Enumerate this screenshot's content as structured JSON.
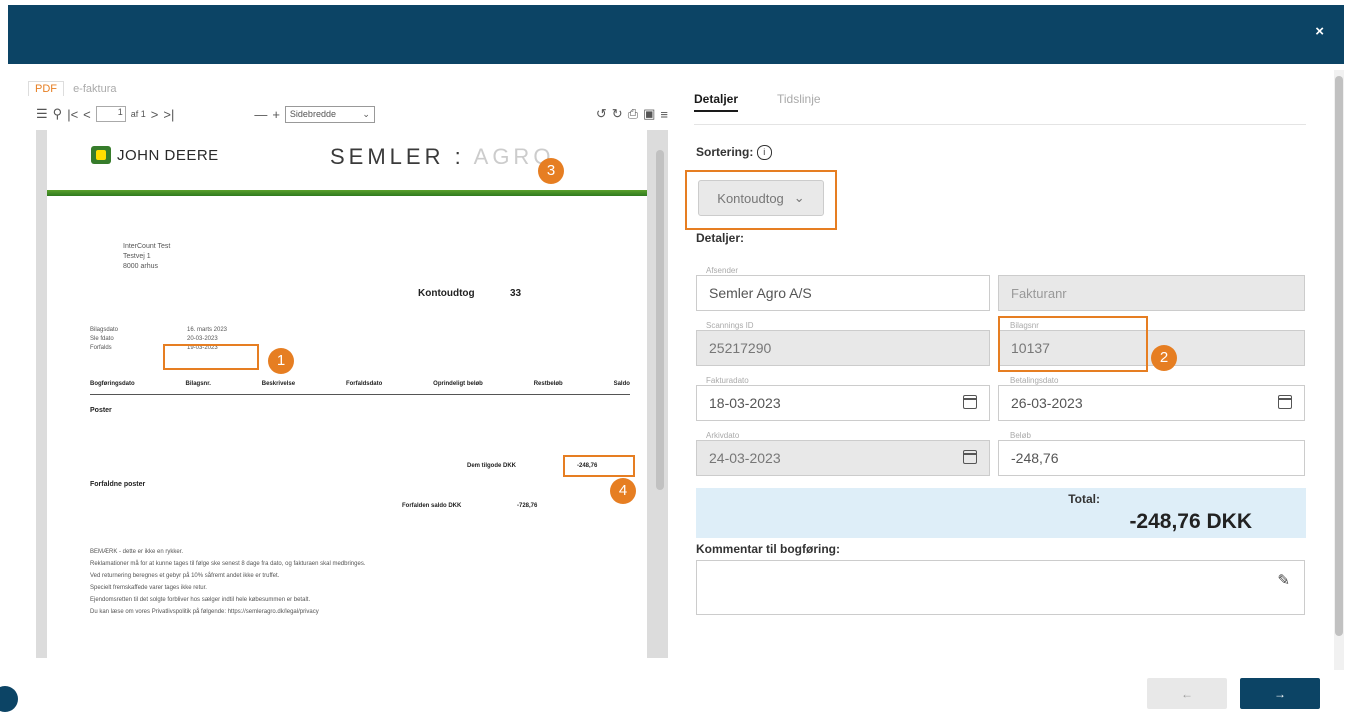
{
  "header": {
    "close_label": "×"
  },
  "pdf": {
    "tabs": [
      "PDF",
      "e-faktura"
    ],
    "page_current": "1",
    "page_total": "af 1",
    "zoom_label": "Sidebredde",
    "doc": {
      "brand_left": "JOHN DEERE",
      "brand_right_main": "SEMLER",
      "brand_right_colon": ":",
      "brand_right_sub": "AGRO",
      "address": [
        "InterCount Test",
        "Testvej 1",
        "8000 arhus"
      ],
      "doc_title": "Kontoudtog",
      "doc_number": "33",
      "meta_labels": [
        "Bilagsdato",
        "Sle fdato",
        "Forfalds"
      ],
      "meta_values": [
        "16. marts 2023",
        "20-03-2023",
        "19-03-2023"
      ],
      "col_headers": [
        "Bogføringsdato",
        "Bilagsnr.",
        "Beskrivelse",
        "Forfaldsdato",
        "Oprindeligt beløb",
        "Restbeløb",
        "Saldo"
      ],
      "section_posts": "Poster",
      "section_overdue": "Forfaldne poster",
      "due_total_label": "Dem tilgode DKK",
      "due_total_value": "-248,76",
      "overdue_total_label": "Forfalden saldo DKK",
      "overdue_total_value": "-728,76",
      "footer_lines": [
        "BEMÆRK - dette er ikke en rykker.",
        "Reklamationer må for at kunne tages til følge ske senest 8 dage fra dato, og fakturaen skal medbringes.",
        "Ved returnering beregnes et gebyr på 10% såfremt andet ikke er truffet.",
        "Specielt fremskaffede varer tages ikke retur.",
        "Ejendomsretten til det solgte forbliver hos sælger indtil hele købesummen er betalt.",
        "Du kan læse om vores Privatlivspolitik på følgende: https://semleragro.dk/legal/privacy"
      ]
    },
    "markers": [
      "1",
      "2",
      "3",
      "4"
    ]
  },
  "right": {
    "tabs": [
      "Detaljer",
      "Tidslinje"
    ],
    "sorting_label": "Sortering:",
    "sorting_info_icon": "i",
    "sorting_value": "Kontoudtog",
    "details_label": "Detaljer:",
    "fields": {
      "sender_label": "Afsender",
      "sender_value": "Semler Agro A/S",
      "invoice_placeholder": "Fakturanr",
      "scan_label": "Scannings ID",
      "scan_value": "25217290",
      "voucher_label": "Bilagsnr",
      "voucher_value": "10137",
      "invoice_date_label": "Fakturadato",
      "invoice_date_value": "18-03-2023",
      "pay_date_label": "Betalingsdato",
      "pay_date_value": "26-03-2023",
      "archive_label": "Arkivdato",
      "archive_value": "24-03-2023",
      "amount_label": "Beløb",
      "amount_value": "-248,76"
    },
    "total_label": "Total:",
    "total_value": "-248,76 DKK",
    "comment_label": "Kommentar til bogføring:",
    "prev_label": "←",
    "next_label": "→"
  },
  "colors": {
    "header_bg": "#0c4465",
    "accent": "#e67e22",
    "total_bg": "#deeef8"
  }
}
